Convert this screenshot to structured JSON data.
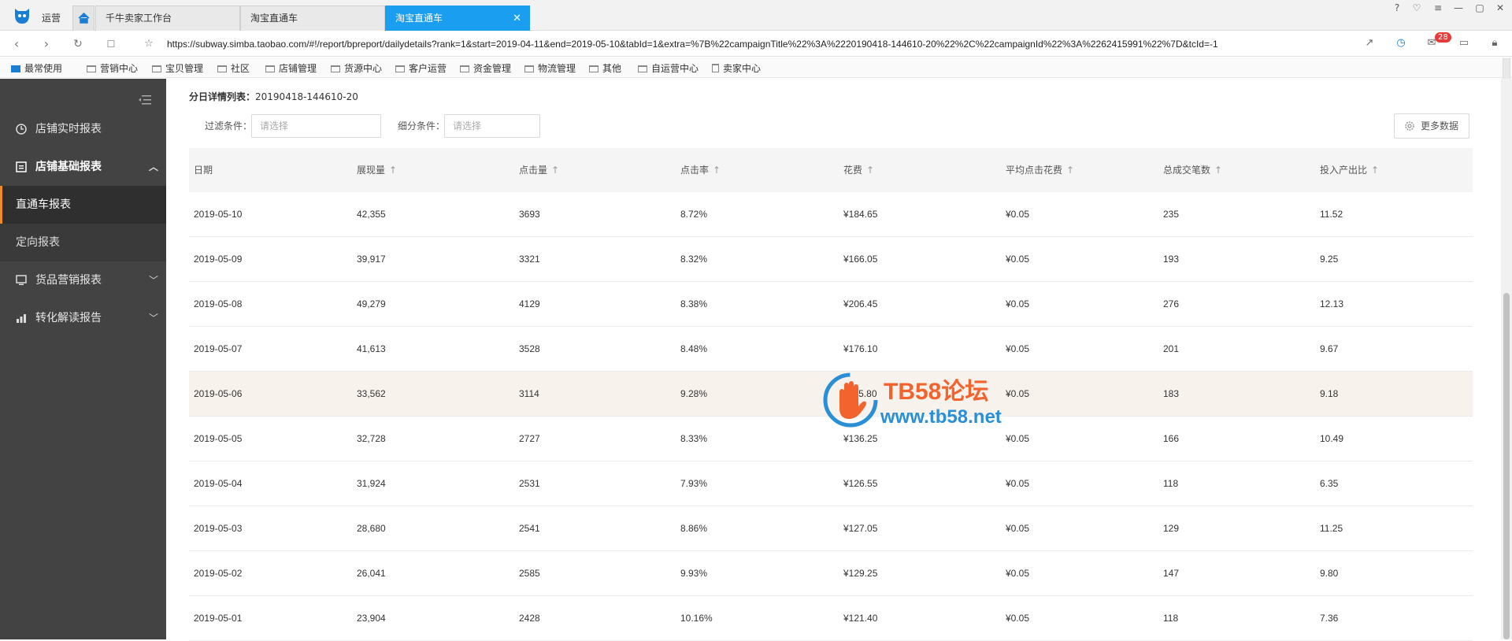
{
  "tabbar": {
    "app_name": "运营",
    "tabs": [
      {
        "label": "千牛卖家工作台"
      },
      {
        "label": "淘宝直通车"
      },
      {
        "label": "淘宝直通车"
      }
    ],
    "close_glyph": "✕",
    "window_controls": [
      "?",
      "♡",
      "≡",
      "—",
      "▢",
      "✕"
    ]
  },
  "address": {
    "url": "https://subway.simba.taobao.com/#!/report/bpreport/dailydetails?rank=1&start=2019-04-11&end=2019-05-10&tabId=1&extra=%7B%22campaignTitle%22%3A%2220190418-144610-20%22%2C%22campaignId%22%3A%2262415991%22%7D&tcId=-1",
    "mail_badge": "28"
  },
  "bookmarks": [
    "最常使用",
    "营销中心",
    "宝贝管理",
    "社区",
    "店铺管理",
    "货源中心",
    "客户运营",
    "资金管理",
    "物流管理",
    "其他",
    "自运营中心",
    "卖家中心"
  ],
  "sidebar": {
    "items": [
      {
        "label": "店铺实时报表",
        "icon": "clock-icon"
      },
      {
        "label": "店铺基础报表",
        "icon": "report-icon"
      },
      {
        "label": "直通车报表"
      },
      {
        "label": "定向报表"
      },
      {
        "label": "货品营销报表",
        "icon": "monitor-icon"
      },
      {
        "label": "转化解读报告",
        "icon": "bar-chart-icon"
      }
    ],
    "accent": "#f08a24"
  },
  "main": {
    "detail_label": "分日详情列表：",
    "detail_value": "20190418-144610-20",
    "filter_label": "过滤条件：",
    "filter_placeholder": "请选择",
    "segment_label": "细分条件：",
    "segment_placeholder": "请选择",
    "more_button": "更多数据"
  },
  "table": {
    "columns": [
      {
        "label": "日期"
      },
      {
        "label": "展现量",
        "sortable": true
      },
      {
        "label": "点击量",
        "sortable": true
      },
      {
        "label": "点击率",
        "sortable": true
      },
      {
        "label": "花费",
        "sortable": true
      },
      {
        "label": "平均点击花费",
        "sortable": true
      },
      {
        "label": "总成交笔数",
        "sortable": true
      },
      {
        "label": "投入产出比",
        "sortable": true
      }
    ],
    "rows": [
      [
        "2019-05-10",
        "42,355",
        "3693",
        "8.72%",
        "¥184.65",
        "¥0.05",
        "235",
        "11.52"
      ],
      [
        "2019-05-09",
        "39,917",
        "3321",
        "8.32%",
        "¥166.05",
        "¥0.05",
        "193",
        "9.25"
      ],
      [
        "2019-05-08",
        "49,279",
        "4129",
        "8.38%",
        "¥206.45",
        "¥0.05",
        "276",
        "12.13"
      ],
      [
        "2019-05-07",
        "41,613",
        "3528",
        "8.48%",
        "¥176.10",
        "¥0.05",
        "201",
        "9.67"
      ],
      [
        "2019-05-06",
        "33,562",
        "3114",
        "9.28%",
        "¥115.80",
        "¥0.05",
        "183",
        "9.18"
      ],
      [
        "2019-05-05",
        "32,728",
        "2727",
        "8.33%",
        "¥136.25",
        "¥0.05",
        "166",
        "10.49"
      ],
      [
        "2019-05-04",
        "31,924",
        "2531",
        "7.93%",
        "¥126.55",
        "¥0.05",
        "118",
        "6.35"
      ],
      [
        "2019-05-03",
        "28,680",
        "2541",
        "8.86%",
        "¥127.05",
        "¥0.05",
        "129",
        "11.25"
      ],
      [
        "2019-05-02",
        "26,041",
        "2585",
        "9.93%",
        "¥129.25",
        "¥0.05",
        "147",
        "9.80"
      ],
      [
        "2019-05-01",
        "23,904",
        "2428",
        "10.16%",
        "¥121.40",
        "¥0.05",
        "118",
        "7.36"
      ]
    ],
    "highlight_row": 4,
    "highlight_color": "#f8f2ed"
  },
  "watermark": {
    "title": "TB58论坛",
    "url": "www.tb58.net"
  }
}
